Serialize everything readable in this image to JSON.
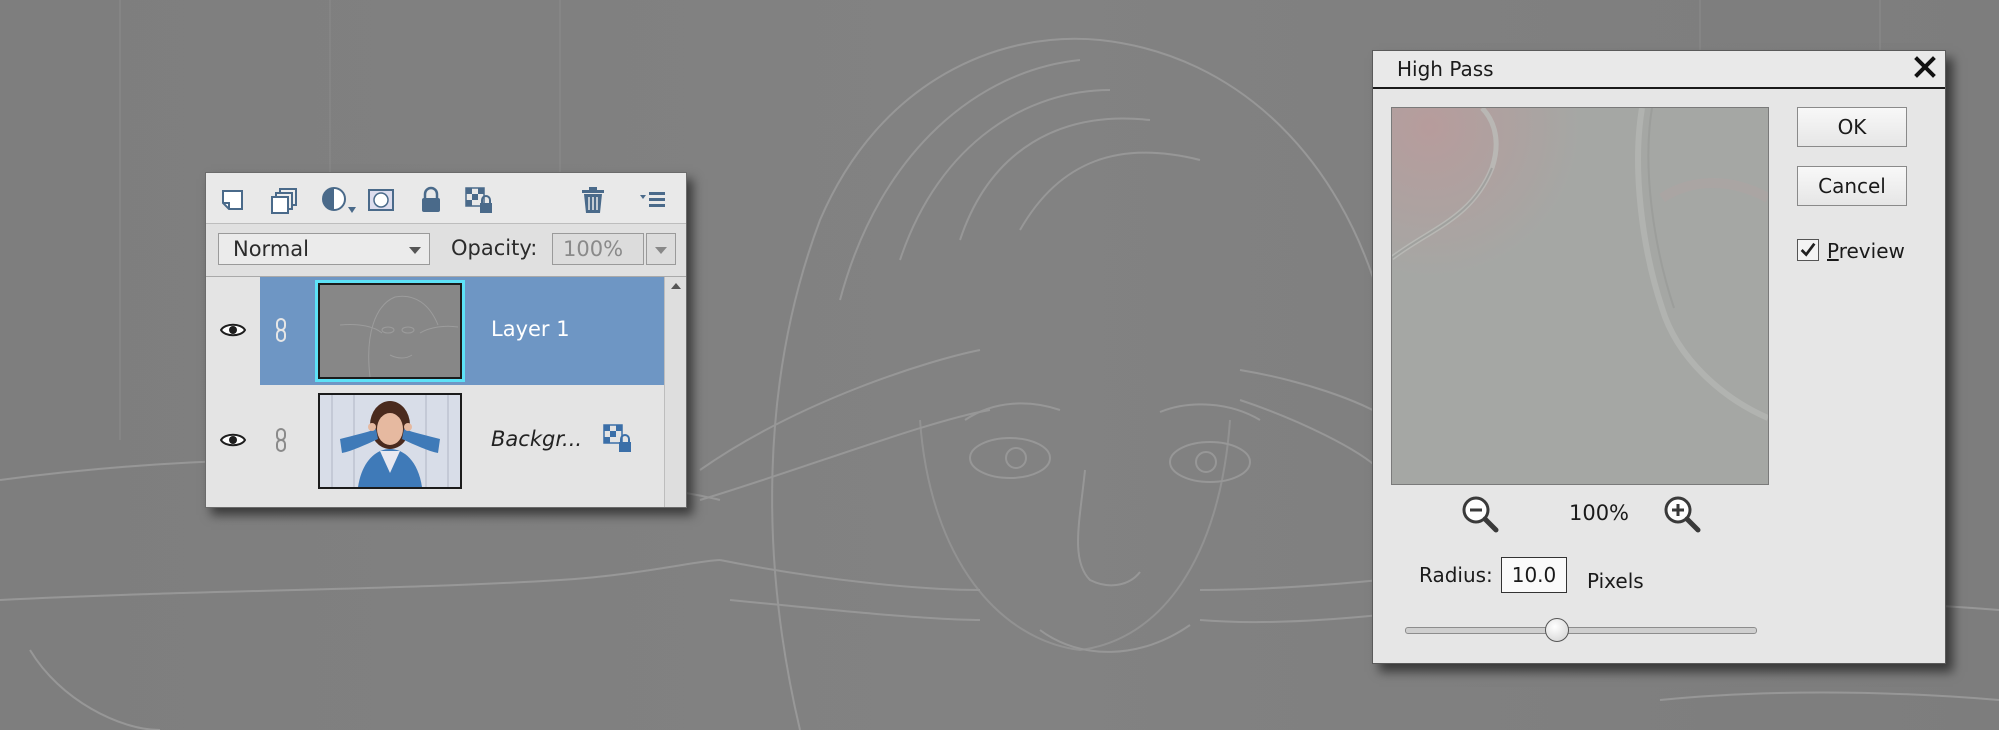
{
  "layers_panel": {
    "toolbar_icons": [
      "new-layer-icon",
      "new-group-icon",
      "adjustment-layer-icon",
      "layer-mask-icon",
      "lock-all-icon",
      "lock-transparency-icon",
      "trash-icon",
      "panel-menu-icon"
    ],
    "blend_mode": "Normal",
    "opacity_label": "Opacity:",
    "opacity_value": "100%",
    "layers": [
      {
        "name": "Layer 1",
        "selected": true
      },
      {
        "name": "Backgr...",
        "selected": false,
        "locked": true
      }
    ]
  },
  "dialog": {
    "title": "High Pass",
    "ok_label": "OK",
    "cancel_label": "Cancel",
    "preview_prefix": "P",
    "preview_rest": "review",
    "preview_checked": true,
    "zoom": "100%",
    "radius_label": "Radius:",
    "radius_value": "10.0",
    "unit_label": "Pixels",
    "radius_fraction": 0.43
  },
  "colors": {
    "canvas_gray": "#808080",
    "selected_layer": "#6e96c4",
    "thumb_highlight": "#5de1f6"
  }
}
